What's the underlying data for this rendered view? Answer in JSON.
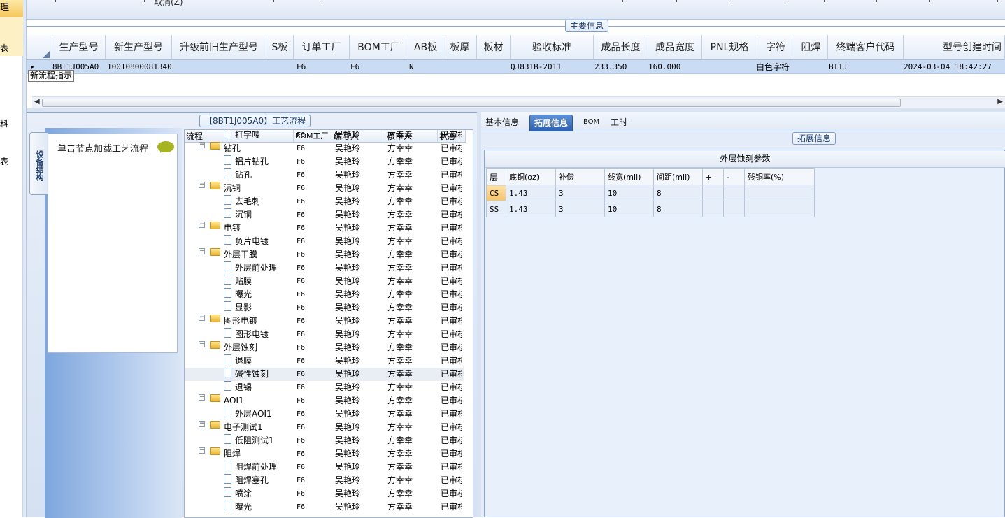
{
  "left_nav": {
    "selected": "理",
    "items": [
      "表",
      "料",
      "表"
    ]
  },
  "toolbar": {
    "cancel_label": "取消(Z)"
  },
  "main_info": {
    "title": "主要信息",
    "columns": [
      "生产型号",
      "新生产型号",
      "升级前旧生产型号",
      "S板",
      "订单工厂",
      "BOM工厂",
      "AB板",
      "板厚",
      "板材",
      "验收标准",
      "成品长度",
      "成品宽度",
      "PNL规格",
      "字符",
      "阻焊",
      "终端客户代码",
      "型号创建时间"
    ],
    "row": [
      "8BT1J005A0",
      "10010800081340",
      "",
      "",
      "F6",
      "F6",
      "N",
      "",
      "",
      "QJ831B-2011",
      "233.350",
      "160.000",
      "",
      "白色字符",
      "",
      "BT1J",
      "2024-03-04 18:42:27"
    ],
    "tooltip": "新流程指示"
  },
  "process": {
    "title": "【8BT1J005A0】工艺流程",
    "vertical_tab": "设备结构",
    "node_hint": "单击节点加载工艺流程",
    "columns": [
      "流程",
      "BOM工厂",
      "编写人",
      "核审人",
      "状态"
    ],
    "rows": [
      {
        "name": "打字唛",
        "level": 2,
        "bom": "F6",
        "editor": "吴艳玲",
        "reviewer": "方幸幸",
        "status": "已审核"
      },
      {
        "name": "钻孔",
        "level": 1,
        "bom": "F6",
        "editor": "吴艳玲",
        "reviewer": "方幸幸",
        "status": "已审核"
      },
      {
        "name": "铝片钻孔",
        "level": 2,
        "bom": "F6",
        "editor": "吴艳玲",
        "reviewer": "方幸幸",
        "status": "已审核"
      },
      {
        "name": "钻孔",
        "level": 2,
        "bom": "F6",
        "editor": "吴艳玲",
        "reviewer": "方幸幸",
        "status": "已审核"
      },
      {
        "name": "沉铜",
        "level": 1,
        "bom": "F6",
        "editor": "吴艳玲",
        "reviewer": "方幸幸",
        "status": "已审核"
      },
      {
        "name": "去毛刺",
        "level": 2,
        "bom": "F6",
        "editor": "吴艳玲",
        "reviewer": "方幸幸",
        "status": "已审核"
      },
      {
        "name": "沉铜",
        "level": 2,
        "bom": "F6",
        "editor": "吴艳玲",
        "reviewer": "方幸幸",
        "status": "已审核"
      },
      {
        "name": "电镀",
        "level": 1,
        "bom": "F6",
        "editor": "吴艳玲",
        "reviewer": "方幸幸",
        "status": "已审核"
      },
      {
        "name": "负片电镀",
        "level": 2,
        "bom": "F6",
        "editor": "吴艳玲",
        "reviewer": "方幸幸",
        "status": "已审核"
      },
      {
        "name": "外层干膜",
        "level": 1,
        "bom": "F6",
        "editor": "吴艳玲",
        "reviewer": "方幸幸",
        "status": "已审核"
      },
      {
        "name": "外层前处理",
        "level": 2,
        "bom": "F6",
        "editor": "吴艳玲",
        "reviewer": "方幸幸",
        "status": "已审核"
      },
      {
        "name": "贴膜",
        "level": 2,
        "bom": "F6",
        "editor": "吴艳玲",
        "reviewer": "方幸幸",
        "status": "已审核"
      },
      {
        "name": "曝光",
        "level": 2,
        "bom": "F6",
        "editor": "吴艳玲",
        "reviewer": "方幸幸",
        "status": "已审核"
      },
      {
        "name": "显影",
        "level": 2,
        "bom": "F6",
        "editor": "吴艳玲",
        "reviewer": "方幸幸",
        "status": "已审核"
      },
      {
        "name": "图形电镀",
        "level": 1,
        "bom": "F6",
        "editor": "吴艳玲",
        "reviewer": "方幸幸",
        "status": "已审核"
      },
      {
        "name": "图形电镀",
        "level": 2,
        "bom": "F6",
        "editor": "吴艳玲",
        "reviewer": "方幸幸",
        "status": "已审核"
      },
      {
        "name": "外层蚀刻",
        "level": 1,
        "bom": "F6",
        "editor": "吴艳玲",
        "reviewer": "方幸幸",
        "status": "已审核"
      },
      {
        "name": "退膜",
        "level": 2,
        "bom": "F6",
        "editor": "吴艳玲",
        "reviewer": "方幸幸",
        "status": "已审核"
      },
      {
        "name": "碱性蚀刻",
        "level": 2,
        "bom": "F6",
        "editor": "吴艳玲",
        "reviewer": "方幸幸",
        "status": "已审核",
        "selected": true
      },
      {
        "name": "退锡",
        "level": 2,
        "bom": "F6",
        "editor": "吴艳玲",
        "reviewer": "方幸幸",
        "status": "已审核"
      },
      {
        "name": "AOI1",
        "level": 1,
        "bom": "F6",
        "editor": "吴艳玲",
        "reviewer": "方幸幸",
        "status": "已审核"
      },
      {
        "name": "外层AOI1",
        "level": 2,
        "bom": "F6",
        "editor": "吴艳玲",
        "reviewer": "方幸幸",
        "status": "已审核"
      },
      {
        "name": "电子测试1",
        "level": 1,
        "bom": "F6",
        "editor": "吴艳玲",
        "reviewer": "方幸幸",
        "status": "已审核"
      },
      {
        "name": "低阻测试1",
        "level": 2,
        "bom": "F6",
        "editor": "吴艳玲",
        "reviewer": "方幸幸",
        "status": "已审核"
      },
      {
        "name": "阻焊",
        "level": 1,
        "bom": "F6",
        "editor": "吴艳玲",
        "reviewer": "方幸幸",
        "status": "已审核"
      },
      {
        "name": "阻焊前处理",
        "level": 2,
        "bom": "F6",
        "editor": "吴艳玲",
        "reviewer": "方幸幸",
        "status": "已审核"
      },
      {
        "name": "阻焊塞孔",
        "level": 2,
        "bom": "F6",
        "editor": "吴艳玲",
        "reviewer": "方幸幸",
        "status": "已审核"
      },
      {
        "name": "喷涂",
        "level": 2,
        "bom": "F6",
        "editor": "吴艳玲",
        "reviewer": "方幸幸",
        "status": "已审核"
      },
      {
        "name": "曝光",
        "level": 2,
        "bom": "F6",
        "editor": "吴艳玲",
        "reviewer": "方幸幸",
        "status": "已审核"
      }
    ]
  },
  "detail": {
    "tabs": [
      "基本信息",
      "拓展信息",
      "BOM",
      "工时"
    ],
    "active_tab": "拓展信息",
    "section_title": "拓展信息",
    "table_title": "外层蚀刻参数",
    "columns": [
      "层",
      "底铜(oz)",
      "补偿",
      "线宽(mil)",
      "间距(mil)",
      "+",
      "-",
      "残铜率(%)"
    ],
    "rows": [
      [
        "CS",
        "1.43",
        "3",
        "10",
        "8",
        "",
        "",
        ""
      ],
      [
        "SS",
        "1.43",
        "3",
        "10",
        "8",
        "",
        "",
        ""
      ]
    ]
  },
  "colors": {
    "accent": "#2c62b3",
    "selected_row": "#c9dcf4",
    "folder": "#e9b533"
  }
}
